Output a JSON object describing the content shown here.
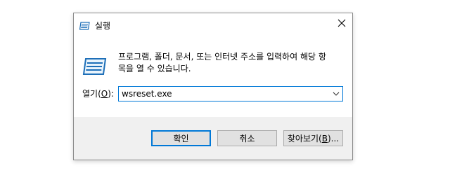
{
  "window": {
    "title": "실행",
    "close_icon": "close-icon",
    "app_icon": "run-icon"
  },
  "content": {
    "description": "프로그램, 폴더, 문서, 또는 인터넷 주소를 입력하여 해당 항\n목을 열 수 있습니다.",
    "open_label_prefix": "열기(",
    "open_label_accel": "O",
    "open_label_suffix": "):",
    "input_value": "wsreset.exe"
  },
  "buttons": {
    "ok": "확인",
    "cancel": "취소",
    "browse_prefix": "찾아보기(",
    "browse_accel": "B",
    "browse_suffix": ")..."
  },
  "colors": {
    "accent": "#0078d7",
    "button_face": "#e1e1e1",
    "dialog_bg": "#f0f0f0"
  }
}
